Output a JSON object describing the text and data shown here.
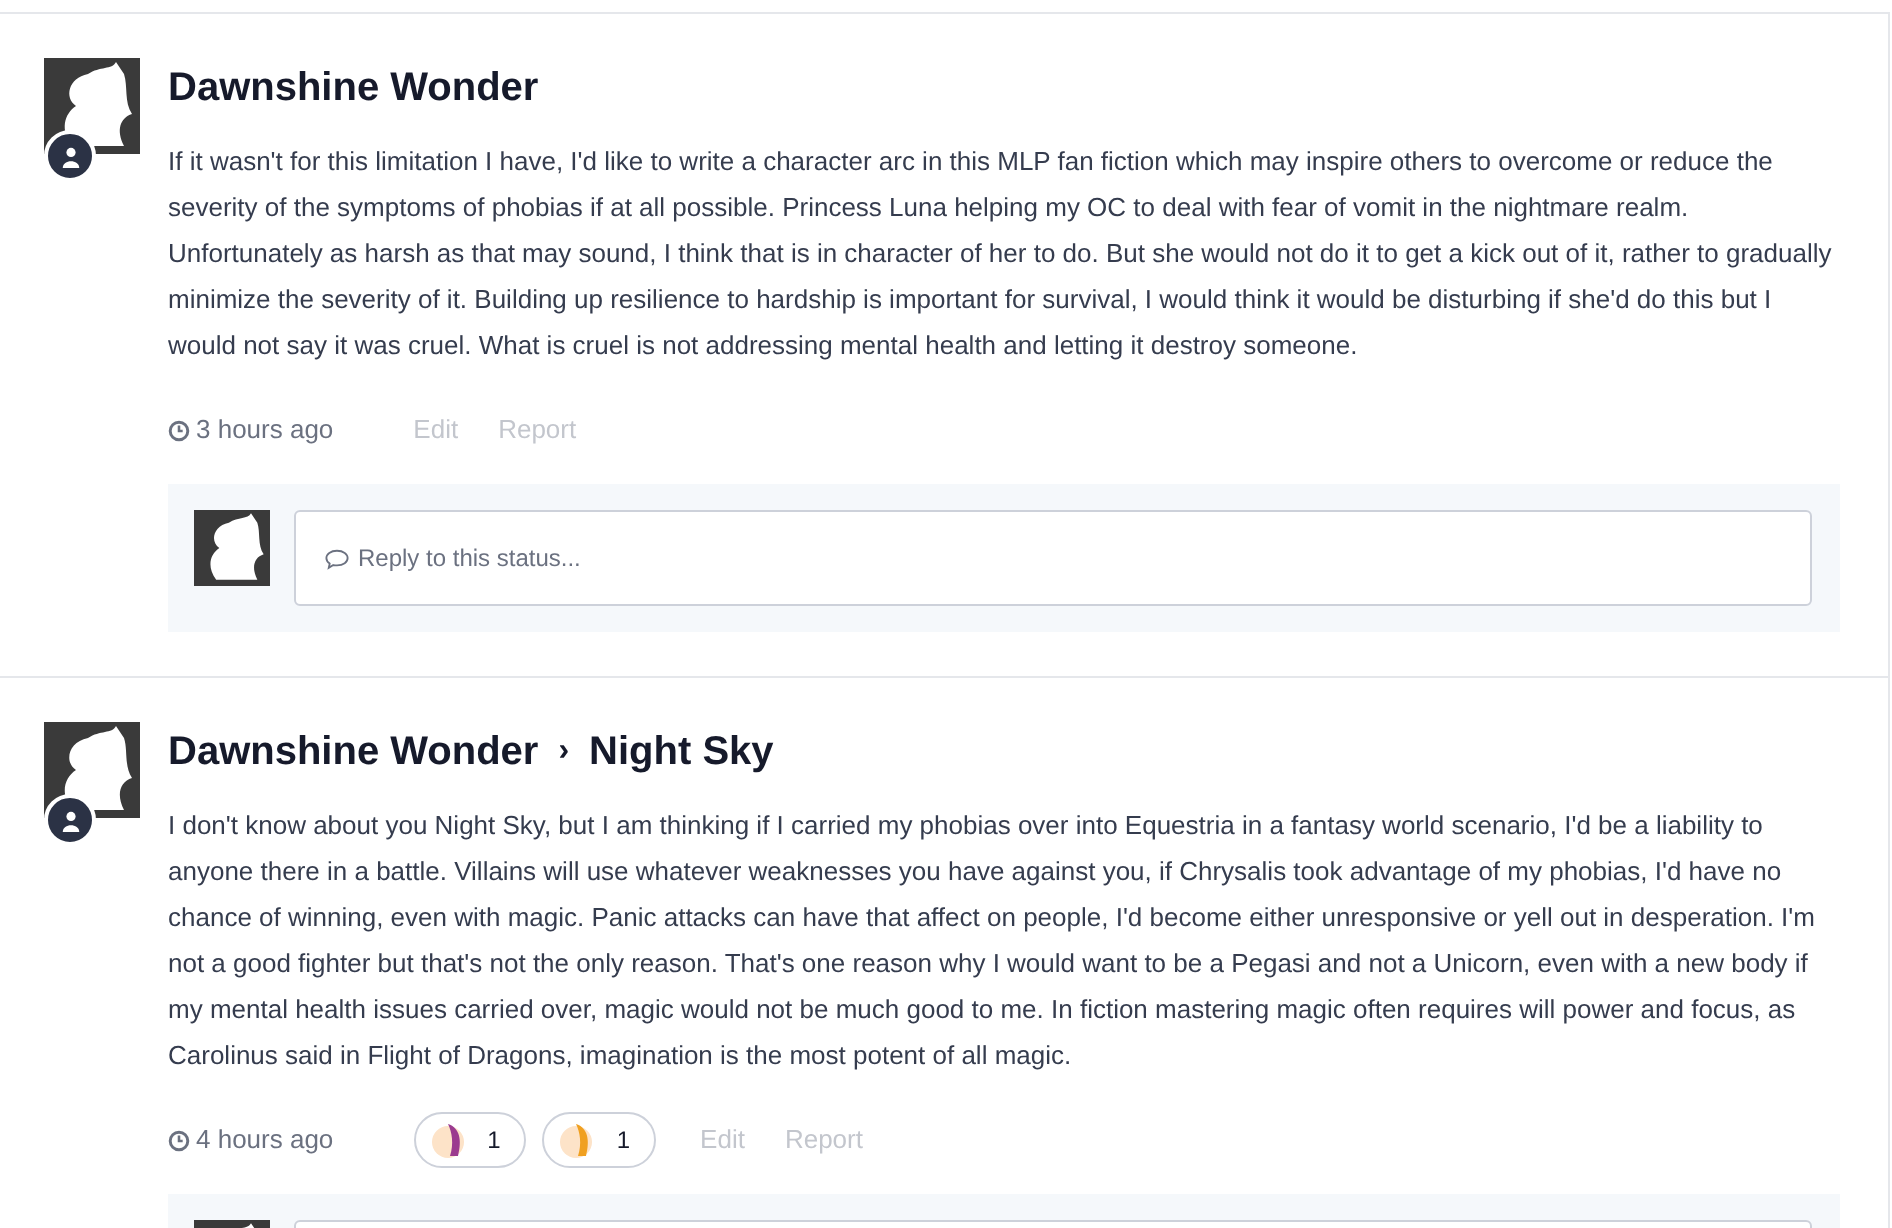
{
  "posts": [
    {
      "author": "Dawnshine Wonder",
      "body": "If it wasn't for this limitation I have, I'd like to write a character arc in this MLP fan fiction which may inspire others to overcome or reduce the severity of the symptoms of phobias if at all possible. Princess Luna helping my OC to deal with fear of vomit in the nightmare realm. Unfortunately as harsh as that may sound, I think that is in character of her to do. But she would not do it to get a kick out of it, rather to gradually minimize the severity of it. Building up resilience to hardship is important for survival, I would think it would be disturbing if she'd do this but I would not say it was cruel. What is cruel is not addressing mental health and letting it destroy someone.",
      "time": "3 hours ago",
      "actions": [
        "Edit",
        "Report"
      ],
      "reply": {
        "placeholder": "Reply to this status..."
      }
    },
    {
      "author": "Dawnshine Wonder",
      "separator": "›",
      "recipient": "Night Sky",
      "body": "I don't know about you Night Sky, but I am thinking if I carried my phobias over into Equestria in a fantasy world scenario, I'd be a liability to anyone there in a battle. Villains will use whatever weaknesses you have against you, if Chrysalis took advantage of my phobias, I'd have no chance of winning, even with magic. Panic attacks can have that affect on people, I'd become either unresponsive or yell out in desperation. I'm not a good fighter but that's not the only reason. That's one reason why I would want to be a Pegasi and not a Unicorn, even with a new body if my mental health issues carried over, magic would not be much good to me. In fiction mastering magic often requires will power and focus, as Carolinus said in Flight of Dragons, imagination is the most potent of all magic.",
      "time": "4 hours ago",
      "reactions": [
        {
          "count": "1",
          "color": "#9b3b8f"
        },
        {
          "count": "1",
          "color": "#f0a020"
        }
      ],
      "actions": [
        "Edit",
        "Report"
      ],
      "reply_box": true
    }
  ]
}
